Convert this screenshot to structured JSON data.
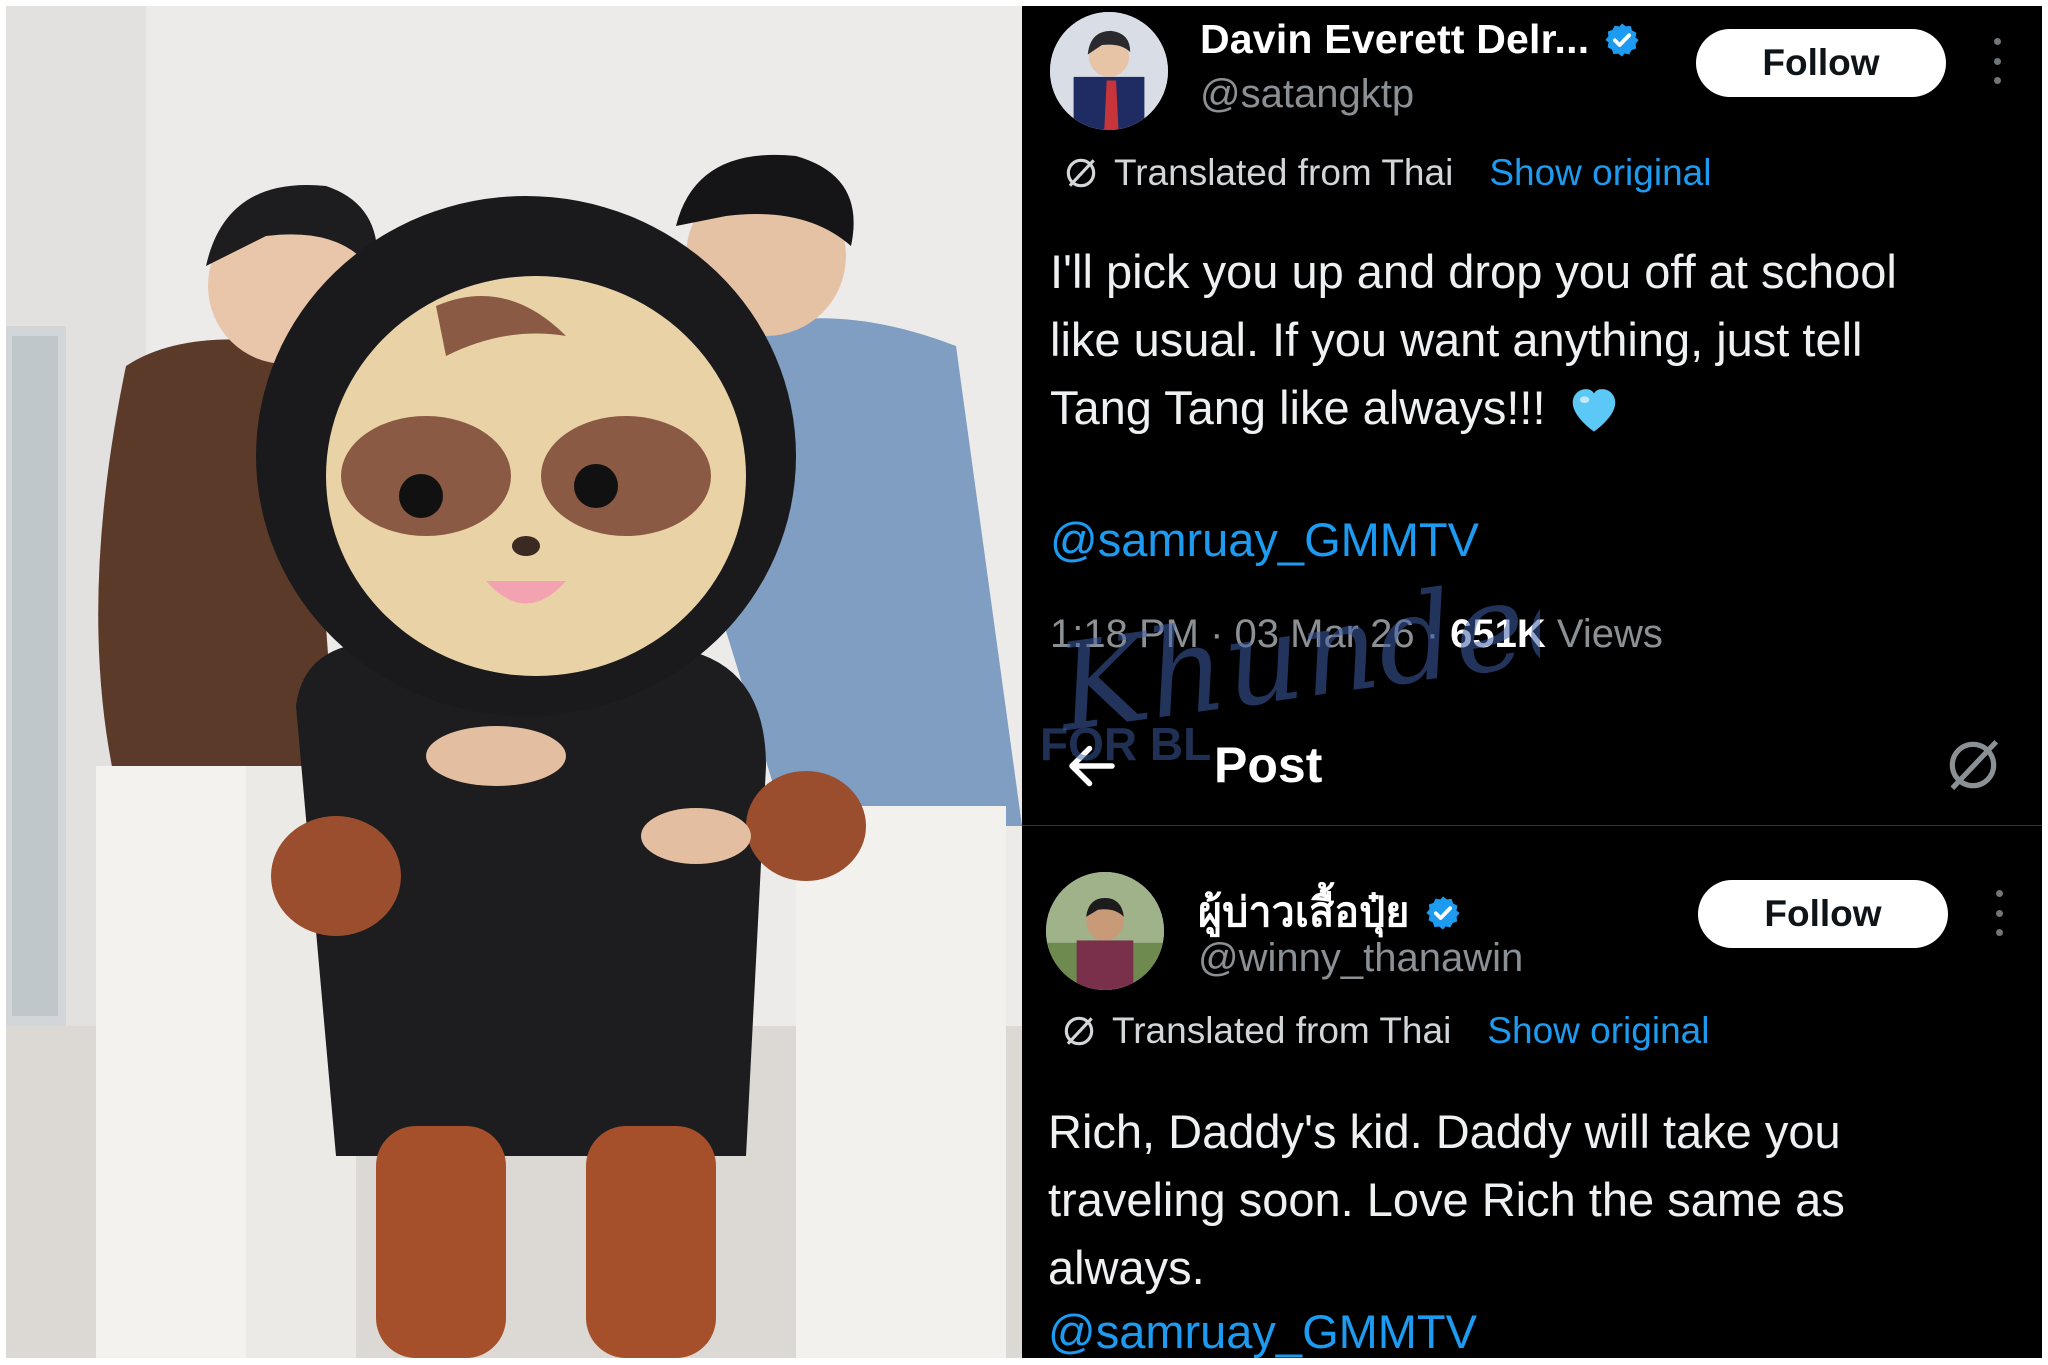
{
  "tweet1": {
    "display_name": "Davin Everett Delr...",
    "handle": "@satangktp",
    "follow_label": "Follow",
    "translated_label": "Translated from Thai",
    "show_original": "Show original",
    "text_lines": [
      "I'll pick you up and drop you off at school",
      "like usual. If you want anything, just tell",
      "Tang Tang like always!!!"
    ],
    "mention": "@samruay_GMMTV",
    "time": "1:18 PM · 03 Mar 26 · ",
    "views_count": "651K",
    "views_label": " Views"
  },
  "post_bar": {
    "title": "Post"
  },
  "tweet2": {
    "display_name": "ผู้บ่าวเสื้อปุ๋ย",
    "handle": "@winny_thanawin",
    "follow_label": "Follow",
    "translated_label": "Translated from Thai",
    "show_original": "Show original",
    "text_lines": [
      "Rich, Daddy's kid. Daddy will take you",
      "traveling soon. Love Rich the same as",
      "always."
    ],
    "mention": "@samruay_GMMTV"
  },
  "watermark": {
    "text": "Khundee",
    "subtext": "FOR BL"
  },
  "colors": {
    "background": "#000000",
    "link": "#1d9bf0",
    "verified": "#1d9bf0",
    "secondary_text": "#8b9095",
    "heart": "#5cc8f5"
  },
  "icons": [
    "verified-badge-icon",
    "translate-icon",
    "more-icon",
    "back-arrow-icon",
    "blue-heart-emoji-icon"
  ]
}
